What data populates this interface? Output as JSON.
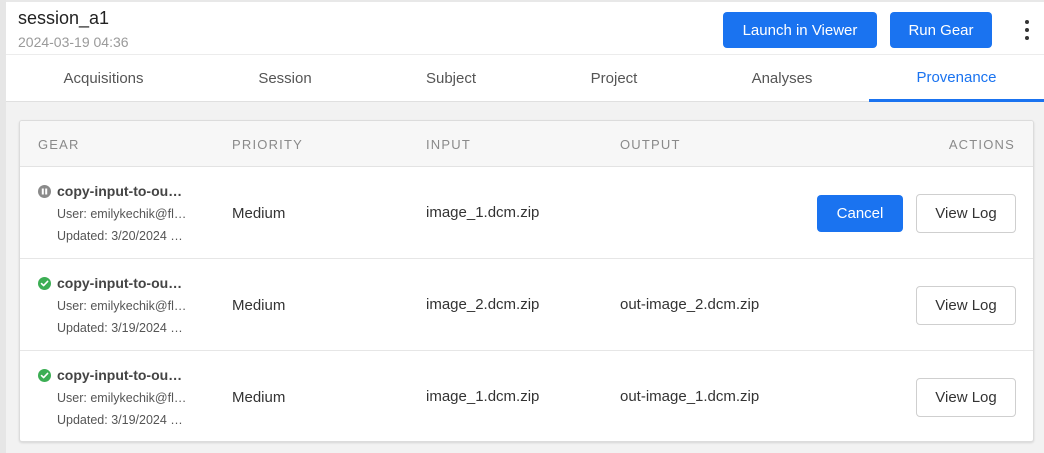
{
  "header": {
    "session_title": "session_a1",
    "session_date": "2024-03-19 04:36",
    "launch_label": "Launch in Viewer",
    "run_gear_label": "Run Gear",
    "more_icon": "vertical-ellipsis-icon"
  },
  "tabs": [
    {
      "label": "Acquisitions",
      "active": false
    },
    {
      "label": "Session",
      "active": false
    },
    {
      "label": "Subject",
      "active": false
    },
    {
      "label": "Project",
      "active": false
    },
    {
      "label": "Analyses",
      "active": false
    },
    {
      "label": "Provenance",
      "active": true
    }
  ],
  "table": {
    "columns": [
      "GEAR",
      "PRIORITY",
      "INPUT",
      "OUTPUT",
      "ACTIONS"
    ],
    "rows": [
      {
        "status_icon": "pause-circle-icon",
        "gear": "copy-input-to-ou…",
        "user": "User: emilykechik@fl…",
        "updated": "Updated: 3/20/2024 …",
        "priority": "Medium",
        "input": "image_1.dcm.zip",
        "output": "",
        "cancel_label": "Cancel",
        "view_log_label": "View Log"
      },
      {
        "status_icon": "check-circle-icon",
        "gear": "copy-input-to-ou…",
        "user": "User: emilykechik@fl…",
        "updated": "Updated: 3/19/2024 …",
        "priority": "Medium",
        "input": "image_2.dcm.zip",
        "output": "out-image_2.dcm.zip",
        "view_log_label": "View Log"
      },
      {
        "status_icon": "check-circle-icon",
        "gear": "copy-input-to-ou…",
        "user": "User: emilykechik@fl…",
        "updated": "Updated: 3/19/2024 …",
        "priority": "Medium",
        "input": "image_1.dcm.zip",
        "output": "out-image_1.dcm.zip",
        "view_log_label": "View Log"
      }
    ]
  },
  "colors": {
    "accent": "#1a73f0",
    "success": "#3cae54",
    "paused": "#8a8a8a"
  }
}
